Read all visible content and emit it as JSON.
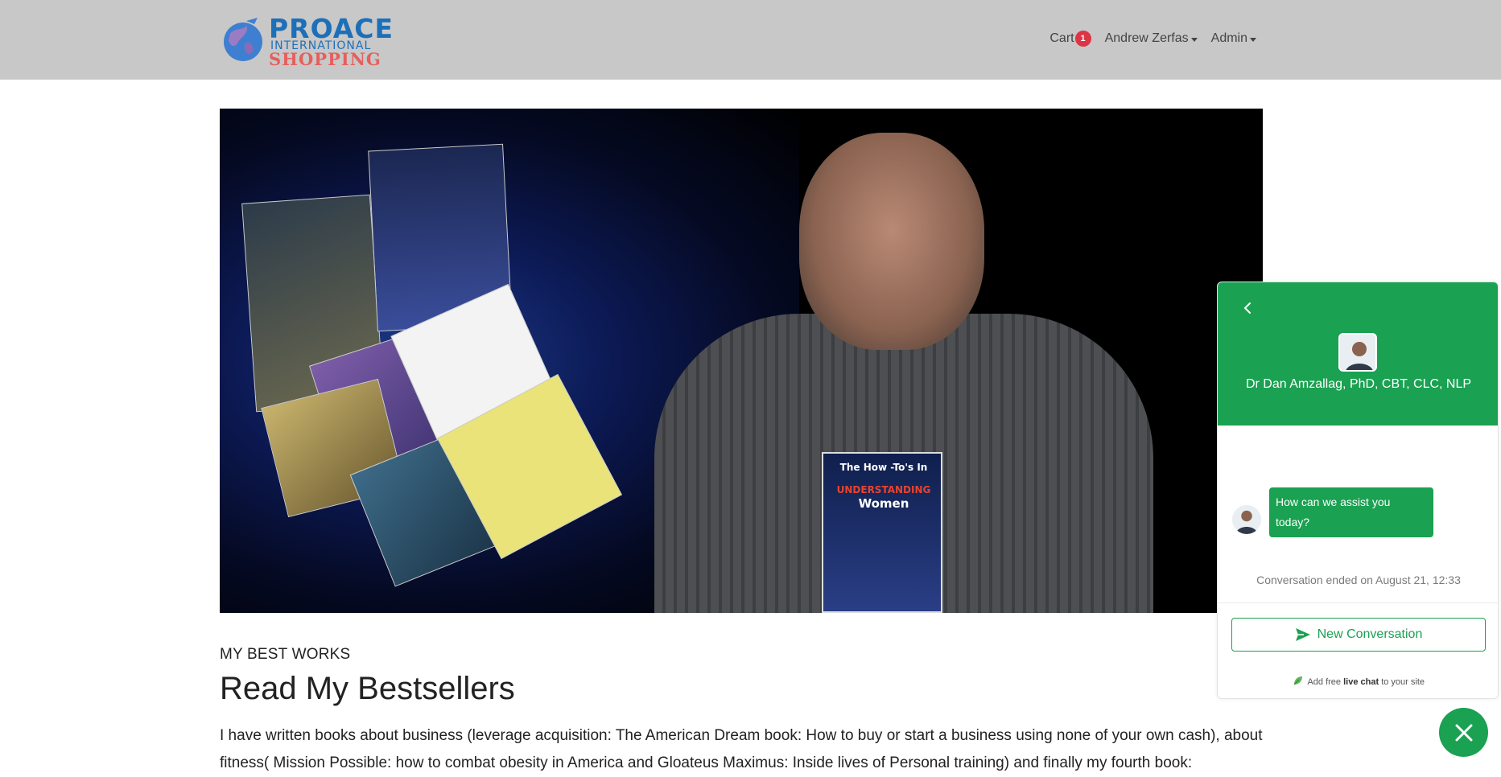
{
  "header": {
    "logo": {
      "line1": "PROACE",
      "line2": "INTERNATIONAL",
      "line3": "SHOPPING"
    },
    "nav": {
      "cart_label": "Cart",
      "cart_count": "1",
      "user_label": "Andrew Zerfas",
      "admin_label": "Admin"
    }
  },
  "hero": {
    "held_book_line1": "The How -To's In",
    "held_book_line2": "UNDERSTANDING",
    "held_book_line3": "Women"
  },
  "content": {
    "kicker": "MY BEST WORKS",
    "title": "Read My Bestsellers",
    "paragraph": "I have written books about business (leverage acquisition: The American Dream book: How to buy or start a business using none of your own cash), about fitness( Mission Possible: how to combat obesity in America and Gloateus Maximus: Inside lives of Personal training) and finally my fourth book:"
  },
  "chat": {
    "agent_name": "Dr Dan Amzallag, PhD, CBT, CLC, NLP",
    "message": "How can we assist you today?",
    "ended_text": "Conversation ended on August 21, 12:33",
    "new_conversation_label": "New Conversation",
    "powered_prefix": "Add free",
    "powered_bold": "live chat",
    "powered_suffix": "to your site",
    "accent_color": "#1aa151"
  },
  "colors": {
    "header_bg": "#c8c8c8",
    "brand_blue": "#1d6fb8",
    "brand_red": "#e4605d",
    "badge": "#dc3545"
  }
}
